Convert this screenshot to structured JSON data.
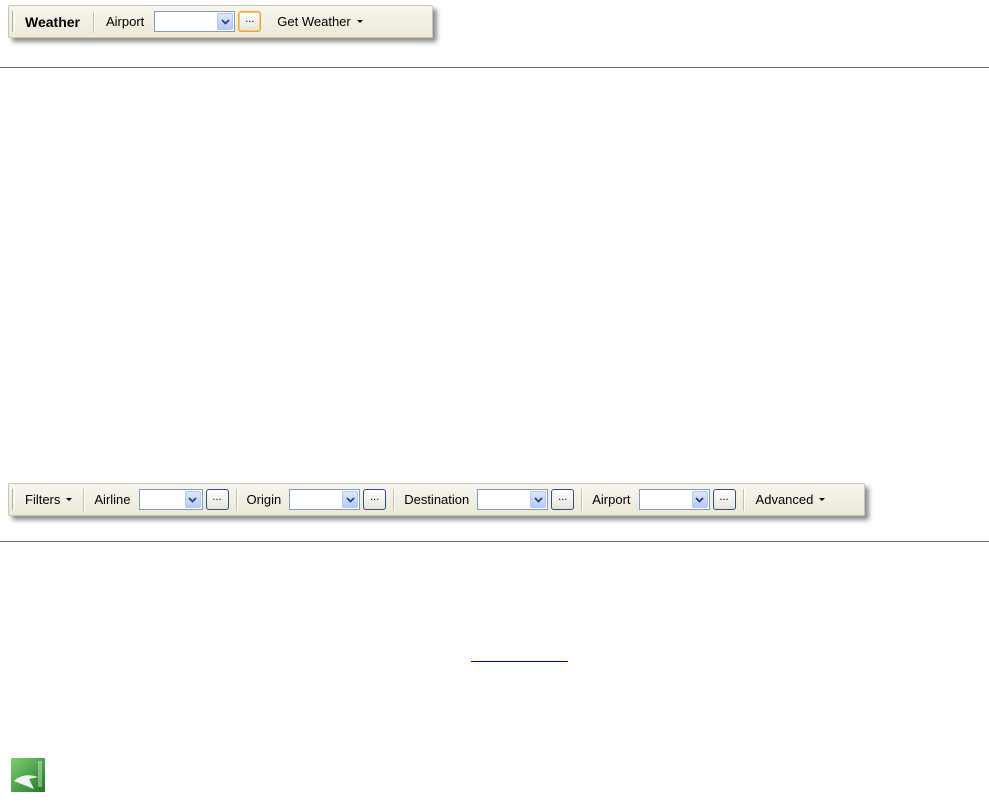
{
  "weather_toolbar": {
    "title": "Weather",
    "airport_label": "Airport",
    "airport_value": "",
    "ellipsis_label": "...",
    "get_weather_label": "Get Weather"
  },
  "filters_toolbar": {
    "filters_label": "Filters",
    "airline_label": "Airline",
    "airline_value": "",
    "origin_label": "Origin",
    "origin_value": "",
    "destination_label": "Destination",
    "destination_value": "",
    "airport_label": "Airport",
    "airport_value": "",
    "ellipsis_label": "...",
    "advanced_label": "Advanced"
  },
  "colors": {
    "toolbar_bg": "#ece9d8",
    "combo_border": "#7f9db9",
    "combo_button": "#b6cbf6",
    "hot_border": "#e5a93a",
    "link": "#0000ee",
    "logo_green": "#3a9a3a"
  },
  "icons": {
    "combo_arrow": "chevron-down-icon",
    "menu_caret": "caret-down-icon",
    "logo": "app-logo-icon"
  }
}
